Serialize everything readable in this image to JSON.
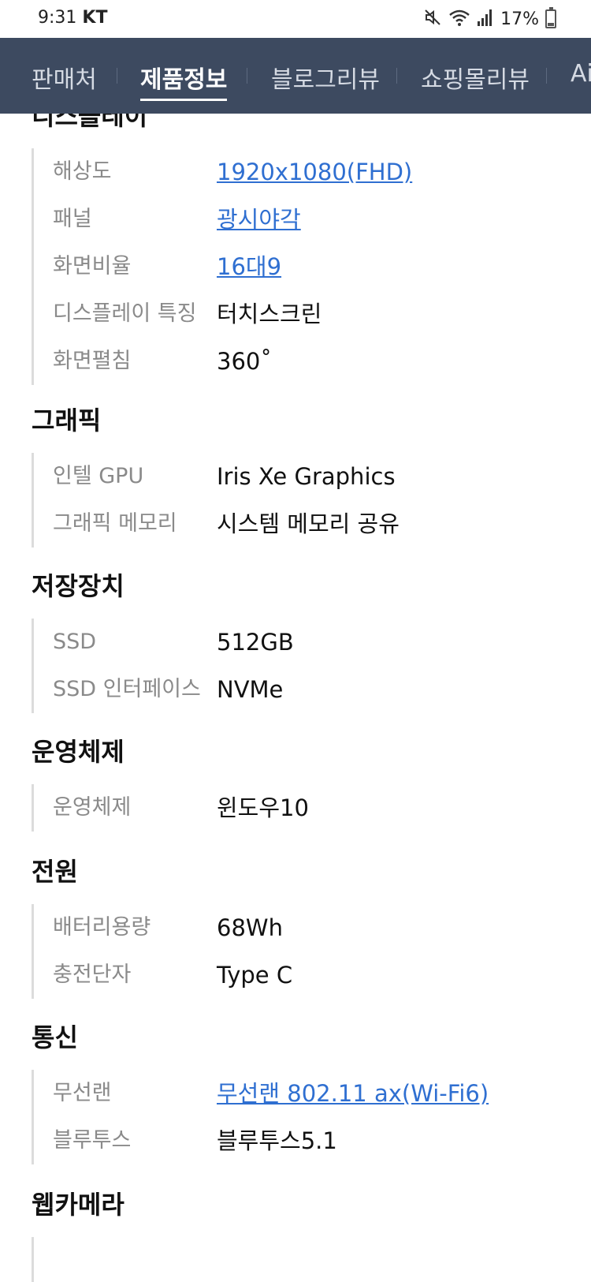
{
  "status": {
    "time": "9:31",
    "carrier": "KT",
    "battery": "17%",
    "icons": [
      "mute-icon",
      "wifi-icon",
      "signal-icon",
      "battery-icon"
    ]
  },
  "tabs": [
    {
      "label": "판매처",
      "active": false
    },
    {
      "label": "제품정보",
      "active": true
    },
    {
      "label": "블로그리뷰",
      "active": false
    },
    {
      "label": "쇼핑몰리뷰",
      "active": false
    },
    {
      "label": "Ai",
      "active": false
    }
  ],
  "sections": {
    "display": {
      "title": "디스플레이",
      "rows": [
        {
          "label": "해상도",
          "value": "1920x1080(FHD)"
        },
        {
          "label": "패널",
          "value": "광시야각"
        },
        {
          "label": "화면비율",
          "value": "16대9"
        },
        {
          "label": "디스플레이 특징",
          "value": "터치스크린"
        },
        {
          "label": "화면펼침",
          "value": "360˚"
        }
      ]
    },
    "graphics": {
      "title": "그래픽",
      "rows": [
        {
          "label": "인텔 GPU",
          "value": "Iris Xe Graphics"
        },
        {
          "label": "그래픽 메모리",
          "value": "시스템 메모리 공유"
        }
      ]
    },
    "storage": {
      "title": "저장장치",
      "rows": [
        {
          "label": "SSD",
          "value": "512GB"
        },
        {
          "label": "SSD 인터페이스",
          "value": "NVMe"
        }
      ]
    },
    "os": {
      "title": "운영체제",
      "rows": [
        {
          "label": "운영체제",
          "value": "윈도우10"
        }
      ]
    },
    "power": {
      "title": "전원",
      "rows": [
        {
          "label": "배터리용량",
          "value": "68Wh"
        },
        {
          "label": "충전단자",
          "value": "Type C"
        }
      ]
    },
    "network": {
      "title": "통신",
      "rows": [
        {
          "label": "무선랜",
          "value": "무선랜 802.11 ax(Wi-Fi6)"
        },
        {
          "label": "블루투스",
          "value": "블루투스5.1"
        }
      ]
    },
    "webcam": {
      "title": "웹카메라"
    }
  },
  "colors": {
    "tab_bar": "#3d4a60",
    "link": "#2f6fd1",
    "label": "#8a8a8a"
  }
}
